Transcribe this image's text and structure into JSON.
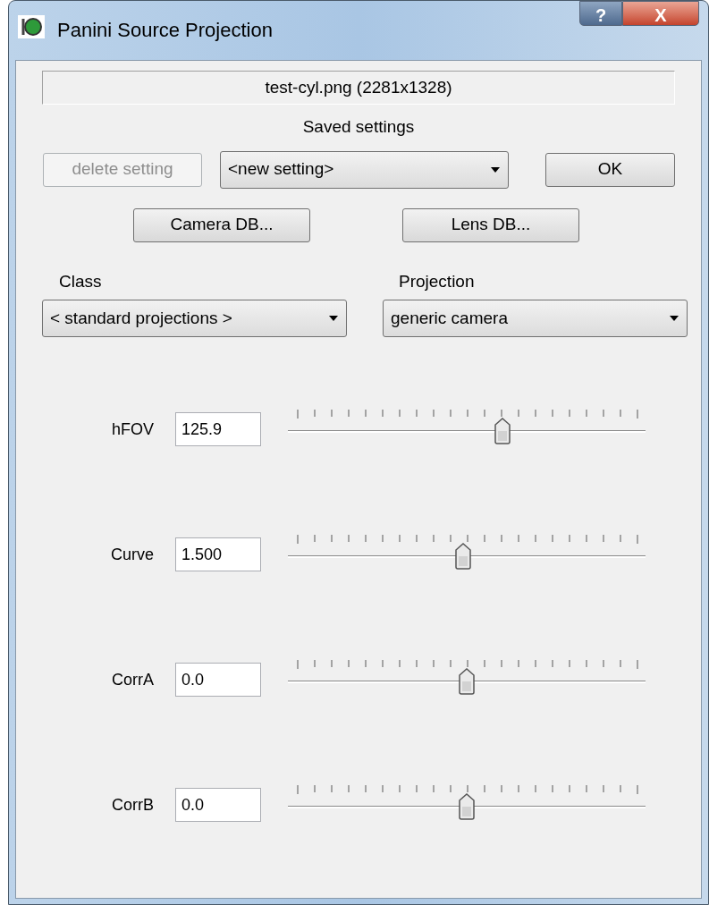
{
  "window": {
    "title": "Panini Source Projection",
    "help_button": "?",
    "close_button": "X"
  },
  "file_label": "test-cyl.png (2281x1328)",
  "saved_settings": {
    "label": "Saved settings",
    "delete_button": {
      "label": "delete setting",
      "disabled": true
    },
    "combo": "<new setting>",
    "ok_button": "OK"
  },
  "db_buttons": [
    "Camera DB...",
    "Lens DB..."
  ],
  "class": {
    "label": "Class",
    "value": "< standard projections >"
  },
  "projection": {
    "label": "Projection",
    "value": "generic camera"
  },
  "parameters": [
    {
      "name": "hFOV",
      "value": "125.9",
      "level": 0.6
    },
    {
      "name": "Curve",
      "value": "1.500",
      "level": 0.49
    },
    {
      "name": "CorrA",
      "value": "0.0",
      "level": 0.5
    },
    {
      "name": "CorrB",
      "value": "0.0",
      "level": 0.5
    }
  ]
}
